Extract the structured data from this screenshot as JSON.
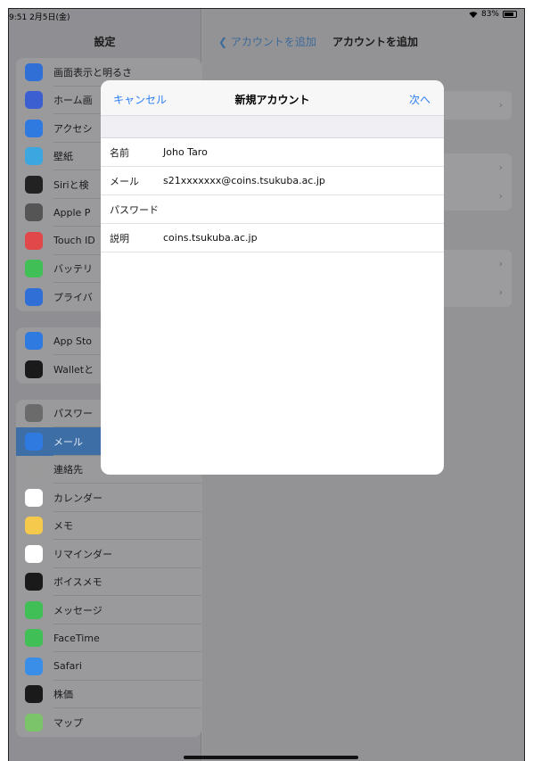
{
  "status_bar": {
    "time": "9:51  2月5日(金)",
    "battery_percent": "83%"
  },
  "sidebar": {
    "title": "設定",
    "groups": [
      [
        {
          "label": "画面表示と明るさ",
          "icon": "display-brightness-icon",
          "color": "#2f6fd6"
        },
        {
          "label": "ホーム画",
          "icon": "home-screen-icon",
          "color": "#3b5fd0"
        },
        {
          "label": "アクセシ",
          "icon": "accessibility-icon",
          "color": "#2f7ae0"
        },
        {
          "label": "壁紙",
          "icon": "wallpaper-icon",
          "color": "#3ba6e0"
        },
        {
          "label": "Siriと検",
          "icon": "siri-icon",
          "color": "#222222"
        },
        {
          "label": "Apple P",
          "icon": "apple-pencil-icon",
          "color": "#555555"
        },
        {
          "label": "Touch ID",
          "icon": "touch-id-icon",
          "color": "#e0484a"
        },
        {
          "label": "バッテリ",
          "icon": "battery-icon",
          "color": "#3fbf55"
        },
        {
          "label": "プライバ",
          "icon": "privacy-hand-icon",
          "color": "#2f6fd6"
        }
      ],
      [
        {
          "label": "App Sto",
          "icon": "app-store-icon",
          "color": "#2f7ae0"
        },
        {
          "label": "Walletと",
          "icon": "wallet-icon",
          "color": "#1a1a1a"
        }
      ],
      [
        {
          "label": "パスワー",
          "icon": "key-icon",
          "color": "#6b6b6b"
        },
        {
          "label": "メール",
          "icon": "mail-icon",
          "color": "#2f7ae0",
          "selected": true
        },
        {
          "label": "連絡先",
          "icon": "contacts-icon",
          "color": "#9a9a9a"
        },
        {
          "label": "カレンダー",
          "icon": "calendar-icon",
          "color": "#ffffff"
        },
        {
          "label": "メモ",
          "icon": "notes-icon",
          "color": "#f5c94b"
        },
        {
          "label": "リマインダー",
          "icon": "reminders-icon",
          "color": "#ffffff"
        },
        {
          "label": "ボイスメモ",
          "icon": "voice-memos-icon",
          "color": "#1a1a1a"
        },
        {
          "label": "メッセージ",
          "icon": "messages-icon",
          "color": "#3fbf55"
        },
        {
          "label": "FaceTime",
          "icon": "facetime-icon",
          "color": "#3fbf55"
        },
        {
          "label": "Safari",
          "icon": "safari-icon",
          "color": "#3a8ee8"
        },
        {
          "label": "株価",
          "icon": "stocks-icon",
          "color": "#1a1a1a"
        },
        {
          "label": "マップ",
          "icon": "maps-icon",
          "color": "#7cc46a"
        }
      ]
    ]
  },
  "detail": {
    "back_label": "アカウントを追加",
    "title": "アカウントを追加",
    "chevron": "›"
  },
  "modal": {
    "cancel_label": "キャンセル",
    "title": "新規アカウント",
    "next_label": "次へ",
    "fields": [
      {
        "label": "名前",
        "value": "Joho Taro"
      },
      {
        "label": "メール",
        "value": "s21xxxxxxx@coins.tsukuba.ac.jp"
      },
      {
        "label": "パスワード",
        "value": ""
      },
      {
        "label": "説明",
        "value": "coins.tsukuba.ac.jp"
      }
    ]
  }
}
